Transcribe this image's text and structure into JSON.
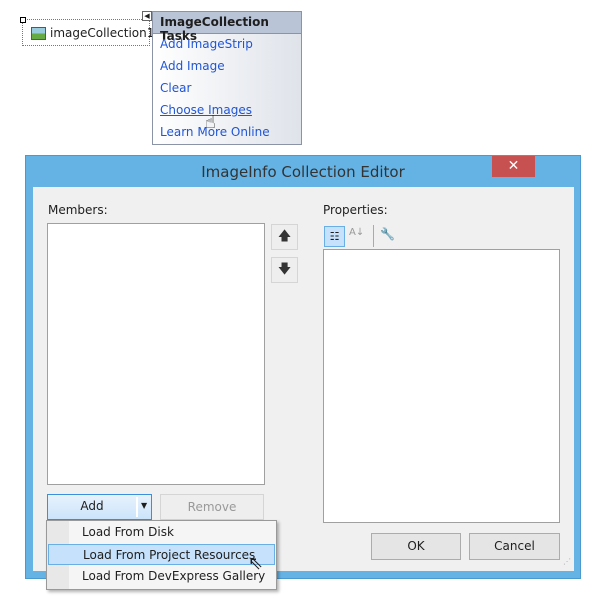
{
  "component": {
    "label": "imageCollection1"
  },
  "tasks": {
    "title": "ImageCollection Tasks",
    "items": [
      "Add ImageStrip",
      "Add Image",
      "Clear",
      "Choose Images",
      "Learn More Online"
    ]
  },
  "dialog": {
    "title": "ImageInfo Collection Editor",
    "help": "?",
    "close": "✕",
    "members_label": "Members:",
    "properties_label": "Properties:",
    "add": "Add",
    "remove": "Remove",
    "ok": "OK",
    "cancel": "Cancel",
    "menu": [
      "Load From Disk",
      "Load From Project Resources",
      "Load From DevExpress Gallery"
    ],
    "selected_menu_item": "Load From Project Resources"
  }
}
